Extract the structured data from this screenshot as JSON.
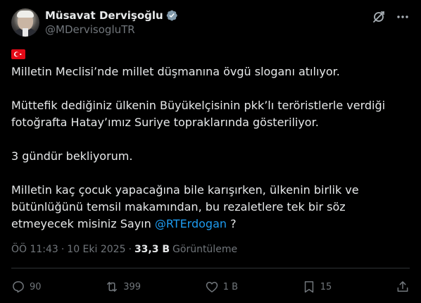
{
  "author": {
    "display_name": "Müsavat Dervişoğlu",
    "handle": "@MDervisogluTR",
    "verified": true,
    "avatar": "avatar-photo"
  },
  "top_actions": {
    "grok_icon": "grok-icon",
    "more_icon": "more-icon"
  },
  "post": {
    "flag_emoji": "turkey-flag-icon",
    "paragraphs": [
      "Milletin Meclisi’nde millet düşmanına övgü sloganı atılıyor.",
      "Müttefik dediğiniz ülkenin Büyükelçisinin pkk’lı teröristlerle verdiği fotoğrafta Hatay’ımız Suriye topraklarında gösteriliyor.",
      "3 gündür bekliyorum."
    ],
    "last_paragraph_before": "Milletin kaç çocuk yapacağına bile karışırken, ülkenin birlik ve bütünlüğünü temsil makamından, bu rezaletlere tek bir söz etmeyecek misiniz Sayın ",
    "mention": "@RTErdogan",
    "last_paragraph_after": " ?"
  },
  "meta": {
    "time": "ÖÖ 11:43",
    "separator": "·",
    "date": "10 Eki 2025",
    "views_count": "33,3 B",
    "views_label": "Görüntüleme"
  },
  "actions": {
    "replies": "90",
    "reposts": "399",
    "likes": "1 B",
    "bookmarks": "15"
  },
  "colors": {
    "background": "#000000",
    "text": "#e7e9ea",
    "secondary": "#71767b",
    "accent": "#1d9bf0",
    "divider": "#2f3336",
    "flag_red": "#e30a17"
  }
}
